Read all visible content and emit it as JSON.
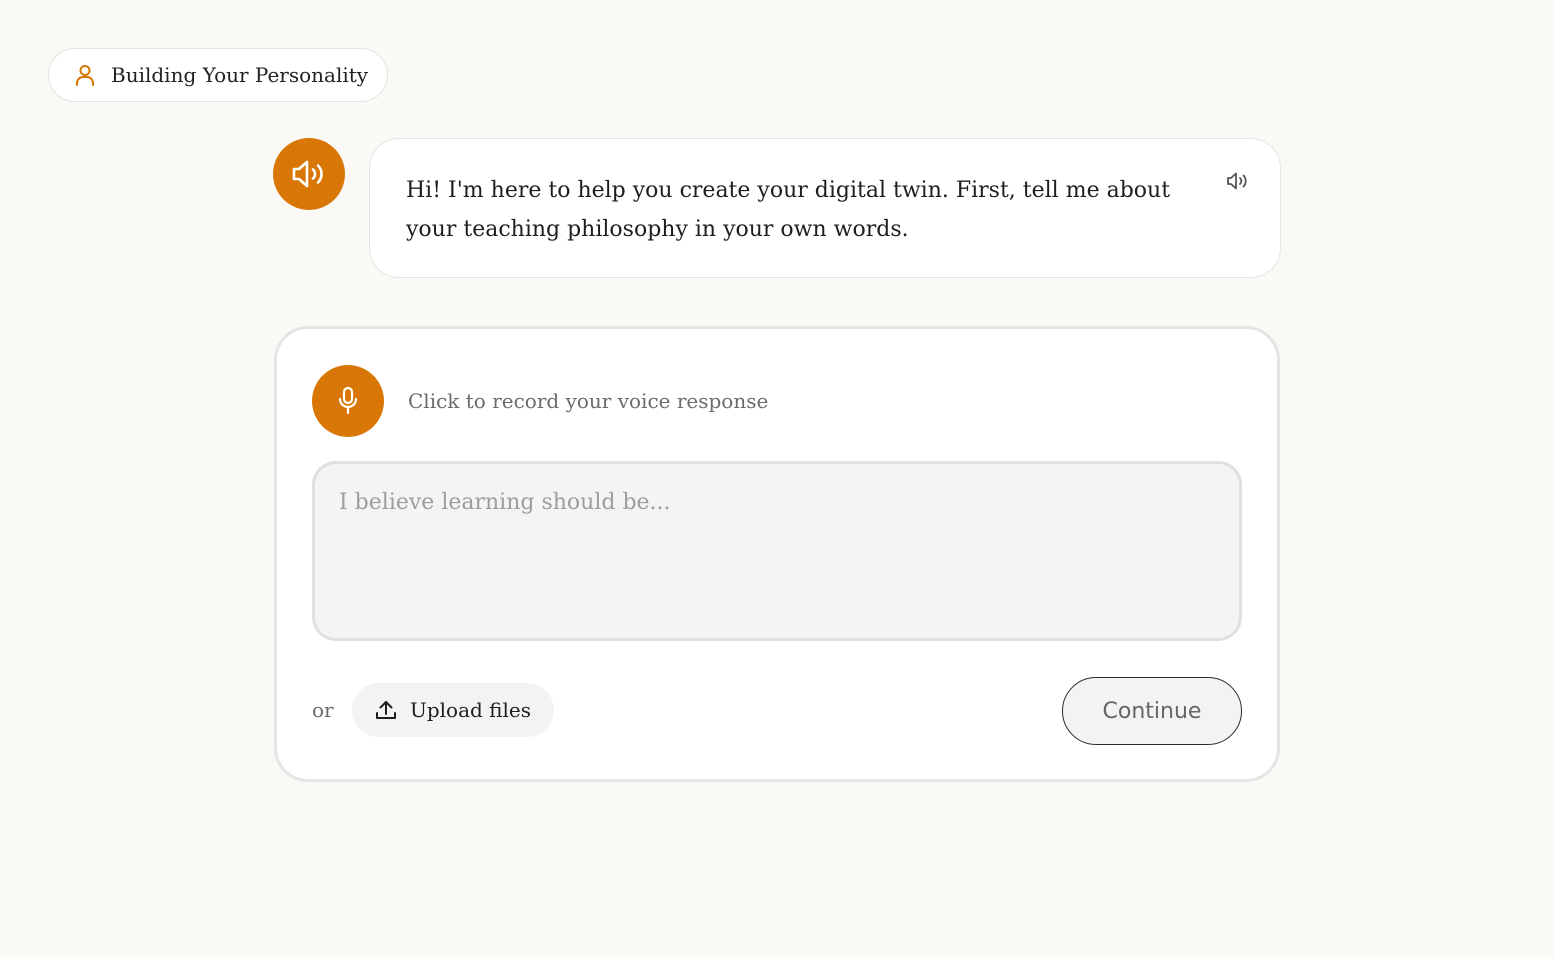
{
  "section": {
    "title": "Building Your Personality",
    "icon": "user-icon"
  },
  "assistant": {
    "avatar_icon": "speaker-icon",
    "message": "Hi! I'm here to help you create your digital twin. First, tell me about your teaching philosophy in your own words.",
    "play_icon": "speaker-icon"
  },
  "response": {
    "record_label": "Click to record your voice response",
    "record_icon": "microphone-icon",
    "textarea_value": "",
    "textarea_placeholder": "I believe learning should be...",
    "or_label": "or",
    "upload_label": "Upload files",
    "upload_icon": "upload-icon",
    "continue_label": "Continue"
  },
  "colors": {
    "accent": "#d97706",
    "background": "#faf9f6"
  }
}
